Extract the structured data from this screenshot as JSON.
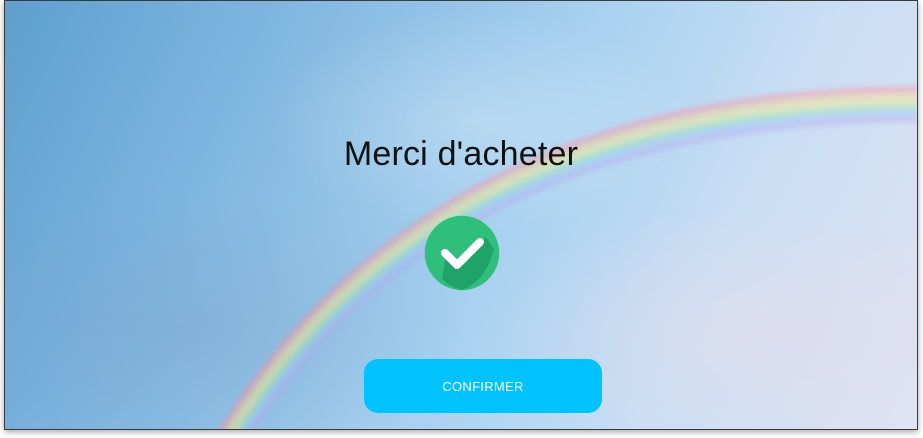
{
  "screen": {
    "title": "Merci d'acheter",
    "status_icon": "check-circle-icon",
    "confirm_label": "CONFIRMER"
  },
  "colors": {
    "accent_button": "#00c2ff",
    "check_green": "#2fbf7a",
    "check_shadow": "#1fa067",
    "title_text": "#111111",
    "button_text": "#ffffff"
  }
}
